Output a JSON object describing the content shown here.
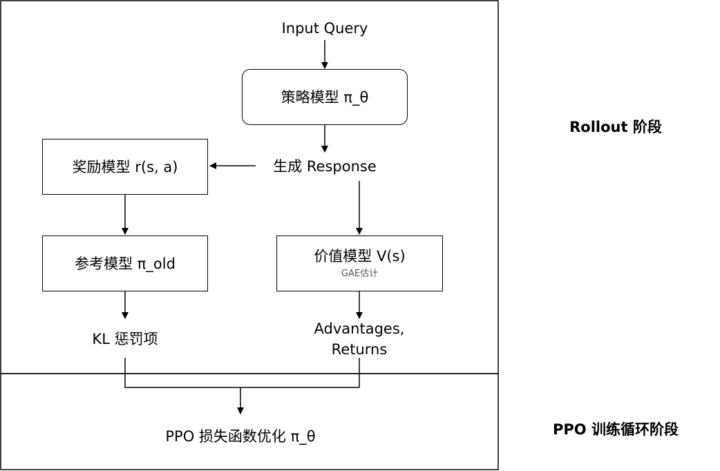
{
  "stages": {
    "rollout": "Rollout 阶段",
    "ppo_training": "PPO 训练循环阶段"
  },
  "nodes": {
    "input_query": "Input Query",
    "policy_model": "策略模型 π_θ",
    "generate_response": "生成 Response",
    "reward_model": "奖励模型 r(s, a)",
    "reference_model": "参考模型 π_old",
    "value_model": "价值模型 V(s)",
    "value_model_sub": "GAE估计",
    "kl_penalty": "KL 惩罚项",
    "advantages_line1": "Advantages,",
    "advantages_line2": "Returns",
    "ppo_optimize": "PPO 损失函数优化 π_θ"
  }
}
